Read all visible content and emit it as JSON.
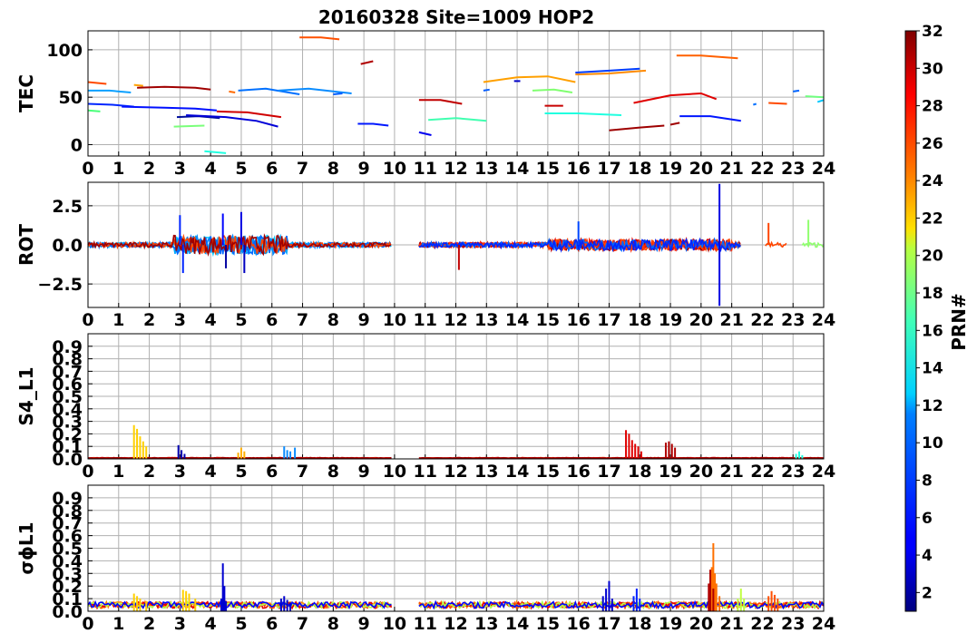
{
  "chart_data": {
    "type": "line",
    "title": "20160328 Site=1009 HOP2",
    "x_ticks": [
      "0",
      "1",
      "2",
      "3",
      "4",
      "5",
      "6",
      "7",
      "8",
      "9",
      "10",
      "11",
      "12",
      "13",
      "14",
      "15",
      "16",
      "17",
      "18",
      "19",
      "20",
      "21",
      "22",
      "23",
      "24"
    ],
    "xlim": [
      0,
      24
    ],
    "grid": true,
    "colorbar": {
      "label": "PRN#",
      "ticks": [
        "2",
        "4",
        "6",
        "8",
        "10",
        "12",
        "14",
        "16",
        "18",
        "20",
        "22",
        "24",
        "26",
        "28",
        "30",
        "32"
      ],
      "range": [
        1,
        32
      ],
      "colormap": "jet"
    },
    "panels": [
      {
        "ylabel": "TEC",
        "ylim": [
          -12,
          120
        ],
        "y_ticks": [
          "0",
          "50",
          "100"
        ],
        "y_tick_values": [
          0,
          50,
          100
        ],
        "series": [
          {
            "prn": 27,
            "color": "#ff4a00",
            "x": [
              0.0,
              0.6
            ],
            "y": [
              66,
              64
            ]
          },
          {
            "prn": 11,
            "color": "#0aa0ff",
            "x": [
              0.0,
              0.7,
              1.4
            ],
            "y": [
              57,
              57,
              55
            ]
          },
          {
            "prn": 6,
            "color": "#0026ff",
            "x": [
              0.0,
              0.8,
              1.5
            ],
            "y": [
              43,
              42,
              40
            ]
          },
          {
            "prn": 16,
            "color": "#4aff7a",
            "x": [
              0.0,
              0.4
            ],
            "y": [
              36,
              35
            ]
          },
          {
            "prn": 24,
            "color": "#ffa100",
            "x": [
              1.5,
              1.8
            ],
            "y": [
              63,
              62
            ]
          },
          {
            "prn": 31,
            "color": "#a00000",
            "x": [
              1.6,
              2.5,
              3.5,
              4.0
            ],
            "y": [
              60,
              61,
              60,
              58
            ]
          },
          {
            "prn": 5,
            "color": "#0010ff",
            "x": [
              1.1,
              2.5,
              3.5,
              4.2
            ],
            "y": [
              40,
              39,
              38,
              36
            ]
          },
          {
            "prn": 2,
            "color": "#000f9c",
            "x": [
              2.9,
              3.6,
              4.3
            ],
            "y": [
              29,
              30,
              28
            ]
          },
          {
            "prn": 17,
            "color": "#7aff7a",
            "x": [
              2.8,
              3.8
            ],
            "y": [
              19,
              20
            ]
          },
          {
            "prn": 13,
            "color": "#20ffe0",
            "x": [
              3.8,
              4.5
            ],
            "y": [
              -7,
              -9
            ]
          },
          {
            "prn": 3,
            "color": "#0000d8",
            "x": [
              3.2,
              4.5,
              5.5,
              6.2
            ],
            "y": [
              31,
              29,
              25,
              19
            ]
          },
          {
            "prn": 29,
            "color": "#d00000",
            "x": [
              4.2,
              5.2,
              6.3
            ],
            "y": [
              35,
              34,
              29
            ]
          },
          {
            "prn": 26,
            "color": "#ff6a00",
            "x": [
              4.6,
              4.8
            ],
            "y": [
              56,
              55
            ]
          },
          {
            "prn": 9,
            "color": "#0070ff",
            "x": [
              4.9,
              5.8,
              6.9
            ],
            "y": [
              57,
              59,
              53
            ]
          },
          {
            "prn": 10,
            "color": "#0a8cff",
            "x": [
              6.2,
              7.2,
              8.6
            ],
            "y": [
              57,
              59,
              54
            ]
          },
          {
            "prn": 8,
            "color": "#005cff",
            "x": [
              8.0,
              8.3
            ],
            "y": [
              53,
              54
            ]
          },
          {
            "prn": 27,
            "color": "#ff5000",
            "x": [
              6.9,
              7.6,
              8.2
            ],
            "y": [
              113,
              113,
              111
            ]
          },
          {
            "prn": 31,
            "color": "#b00000",
            "x": [
              8.9,
              9.3
            ],
            "y": [
              85,
              88
            ]
          },
          {
            "prn": 5,
            "color": "#0018ff",
            "x": [
              8.8,
              9.3,
              9.8
            ],
            "y": [
              22,
              22,
              20
            ]
          },
          {
            "prn": 30,
            "color": "#c00000",
            "x": [
              10.8,
              11.5,
              12.2
            ],
            "y": [
              47,
              47,
              43
            ]
          },
          {
            "prn": 4,
            "color": "#0000f0",
            "x": [
              10.8,
              11.2
            ],
            "y": [
              13,
              10
            ]
          },
          {
            "prn": 15,
            "color": "#40ffb0",
            "x": [
              11.1,
              12.0,
              13.0
            ],
            "y": [
              26,
              28,
              25
            ]
          },
          {
            "prn": 24,
            "color": "#ffa000",
            "x": [
              12.9,
              14.0,
              15.0,
              15.9
            ],
            "y": [
              66,
              71,
              72,
              66
            ]
          },
          {
            "prn": 8,
            "color": "#005cff",
            "x": [
              12.9,
              13.1
            ],
            "y": [
              57,
              58
            ]
          },
          {
            "prn": 3,
            "color": "#0000c8",
            "x": [
              13.9,
              14.1
            ],
            "y": [
              67,
              67
            ]
          },
          {
            "prn": 18,
            "color": "#80ff70",
            "x": [
              14.5,
              15.2,
              15.8
            ],
            "y": [
              57,
              58,
              55
            ]
          },
          {
            "prn": 30,
            "color": "#c80000",
            "x": [
              14.9,
              15.5
            ],
            "y": [
              41,
              41
            ]
          },
          {
            "prn": 13,
            "color": "#20ffe0",
            "x": [
              14.9,
              16.0,
              17.4
            ],
            "y": [
              33,
              33,
              31
            ]
          },
          {
            "prn": 7,
            "color": "#003cff",
            "x": [
              15.9,
              17.0,
              18.0
            ],
            "y": [
              76,
              78,
              80
            ]
          },
          {
            "prn": 25,
            "color": "#ff8a00",
            "x": [
              15.9,
              17.0,
              18.2
            ],
            "y": [
              74,
              75,
              78
            ]
          },
          {
            "prn": 31,
            "color": "#9e0000",
            "x": [
              17.0,
              18.0,
              18.8
            ],
            "y": [
              15,
              18,
              20
            ]
          },
          {
            "prn": 29,
            "color": "#e00000",
            "x": [
              17.8,
              19.0,
              20.0,
              20.5
            ],
            "y": [
              44,
              52,
              54,
              48
            ]
          },
          {
            "prn": 31,
            "color": "#a00000",
            "x": [
              19.0,
              19.3
            ],
            "y": [
              21,
              23
            ]
          },
          {
            "prn": 26,
            "color": "#ff6000",
            "x": [
              19.2,
              20.0,
              21.2
            ],
            "y": [
              94,
              94,
              91
            ]
          },
          {
            "prn": 5,
            "color": "#0016ff",
            "x": [
              19.3,
              20.3,
              21.3
            ],
            "y": [
              30,
              30,
              25
            ]
          },
          {
            "prn": 9,
            "color": "#0070ff",
            "x": [
              21.7,
              21.8
            ],
            "y": [
              42,
              43
            ]
          },
          {
            "prn": 27,
            "color": "#ff4a00",
            "x": [
              22.2,
              22.8
            ],
            "y": [
              44,
              43
            ]
          },
          {
            "prn": 8,
            "color": "#0064ff",
            "x": [
              23.0,
              23.2
            ],
            "y": [
              56,
              57
            ]
          },
          {
            "prn": 17,
            "color": "#70ff80",
            "x": [
              23.4,
              24.0
            ],
            "y": [
              51,
              50
            ]
          },
          {
            "prn": 12,
            "color": "#00c8ff",
            "x": [
              23.8,
              24.0
            ],
            "y": [
              45,
              47
            ]
          }
        ]
      },
      {
        "ylabel": "ROT",
        "ylim": [
          -4,
          4
        ],
        "y_ticks": [
          "−2.5",
          "0.0",
          "2.5"
        ],
        "y_tick_values": [
          -2.5,
          0,
          2.5
        ]
      },
      {
        "ylabel": "S4_L1",
        "ylim": [
          0,
          1
        ],
        "y_ticks": [
          "0.0",
          "0.1",
          "0.2",
          "0.3",
          "0.4",
          "0.5",
          "0.6",
          "0.7",
          "0.8",
          "0.9"
        ],
        "y_tick_values": [
          0,
          0.1,
          0.2,
          0.3,
          0.4,
          0.5,
          0.6,
          0.7,
          0.8,
          0.9
        ],
        "spikes": [
          {
            "color": "#ffd000",
            "x": [
              1.5,
              1.6,
              1.7,
              1.8,
              1.9
            ],
            "y": [
              0.27,
              0.24,
              0.18,
              0.14,
              0.1
            ]
          },
          {
            "color": "#0000b0",
            "x": [
              2.95,
              3.05,
              3.15
            ],
            "y": [
              0.11,
              0.07,
              0.04
            ]
          },
          {
            "color": "#ffb000",
            "x": [
              4.9,
              5.0,
              5.1
            ],
            "y": [
              0.05,
              0.09,
              0.06
            ]
          },
          {
            "color": "#0a8cff",
            "x": [
              6.4,
              6.5,
              6.6,
              6.75
            ],
            "y": [
              0.1,
              0.07,
              0.06,
              0.09
            ]
          },
          {
            "color": "#e00000",
            "x": [
              17.55,
              17.65,
              17.75,
              17.85,
              17.95,
              18.05
            ],
            "y": [
              0.23,
              0.2,
              0.15,
              0.12,
              0.1,
              0.06
            ]
          },
          {
            "color": "#b00000",
            "x": [
              18.85,
              18.95,
              19.05,
              19.15
            ],
            "y": [
              0.13,
              0.14,
              0.12,
              0.09
            ]
          },
          {
            "color": "#20ffe0",
            "x": [
              23.1,
              23.2,
              23.3
            ],
            "y": [
              0.04,
              0.06,
              0.03
            ]
          }
        ]
      },
      {
        "ylabel": "σϕL1",
        "ylim": [
          0,
          1
        ],
        "y_ticks": [
          "0.0",
          "0.1",
          "0.2",
          "0.3",
          "0.4",
          "0.5",
          "0.6",
          "0.7",
          "0.8",
          "0.9"
        ],
        "y_tick_values": [
          0,
          0.1,
          0.2,
          0.3,
          0.4,
          0.5,
          0.6,
          0.7,
          0.8,
          0.9
        ],
        "spikes": [
          {
            "color": "#ffd000",
            "x": [
              1.5,
              1.6,
              1.7,
              1.9
            ],
            "y": [
              0.14,
              0.12,
              0.1,
              0.08
            ]
          },
          {
            "color": "#ffd000",
            "x": [
              3.1,
              3.2,
              3.3,
              3.5
            ],
            "y": [
              0.17,
              0.16,
              0.14,
              0.1
            ]
          },
          {
            "color": "#0000d0",
            "x": [
              4.35,
              4.4,
              4.45,
              4.5
            ],
            "y": [
              0.1,
              0.38,
              0.2,
              0.08
            ]
          },
          {
            "color": "#0000d0",
            "x": [
              6.3,
              6.4,
              6.5,
              6.6
            ],
            "y": [
              0.1,
              0.12,
              0.09,
              0.07
            ]
          },
          {
            "color": "#0000d0",
            "x": [
              16.8,
              16.9,
              17.0,
              17.1
            ],
            "y": [
              0.12,
              0.18,
              0.24,
              0.1
            ]
          },
          {
            "color": "#0020ff",
            "x": [
              17.8,
              17.9,
              18.0
            ],
            "y": [
              0.12,
              0.18,
              0.1
            ]
          },
          {
            "color": "#ff7000",
            "x": [
              20.3,
              20.35,
              20.4,
              20.45,
              20.5,
              20.6
            ],
            "y": [
              0.2,
              0.35,
              0.54,
              0.3,
              0.22,
              0.12
            ]
          },
          {
            "color": "#b00000",
            "x": [
              20.25,
              20.3,
              20.4
            ],
            "y": [
              0.22,
              0.33,
              0.18
            ]
          },
          {
            "color": "#c0ff40",
            "x": [
              21.2,
              21.3,
              21.4
            ],
            "y": [
              0.1,
              0.18,
              0.1
            ]
          },
          {
            "color": "#ff5000",
            "x": [
              22.2,
              22.3,
              22.4,
              22.5
            ],
            "y": [
              0.12,
              0.16,
              0.13,
              0.1
            ]
          }
        ]
      }
    ]
  }
}
